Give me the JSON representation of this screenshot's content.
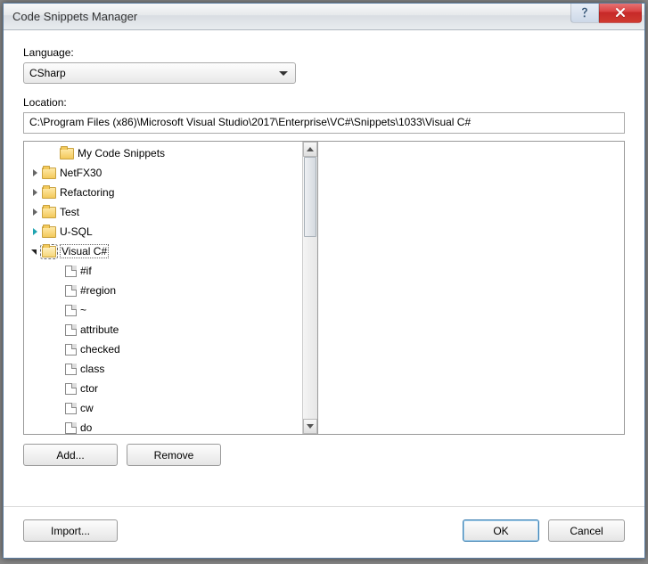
{
  "window": {
    "title": "Code Snippets Manager"
  },
  "labels": {
    "language": "Language:",
    "location": "Location:"
  },
  "language": {
    "selected": "CSharp"
  },
  "location": {
    "value": "C:\\Program Files (x86)\\Microsoft Visual Studio\\2017\\Enterprise\\VC#\\Snippets\\1033\\Visual C#"
  },
  "tree": {
    "folders": [
      {
        "label": "My Code Snippets",
        "expandable": false
      },
      {
        "label": "NetFX30",
        "expandable": true
      },
      {
        "label": "Refactoring",
        "expandable": true
      },
      {
        "label": "Test",
        "expandable": true
      },
      {
        "label": "U-SQL",
        "expandable": true,
        "teal": true
      },
      {
        "label": "Visual C#",
        "expandable": true,
        "expanded": true,
        "selected": true
      }
    ],
    "snippets": [
      {
        "label": "#if"
      },
      {
        "label": "#region"
      },
      {
        "label": "~"
      },
      {
        "label": "attribute"
      },
      {
        "label": "checked"
      },
      {
        "label": "class"
      },
      {
        "label": "ctor"
      },
      {
        "label": "cw"
      },
      {
        "label": "do"
      }
    ]
  },
  "buttons": {
    "add": "Add...",
    "remove": "Remove",
    "import": "Import...",
    "ok": "OK",
    "cancel": "Cancel"
  }
}
